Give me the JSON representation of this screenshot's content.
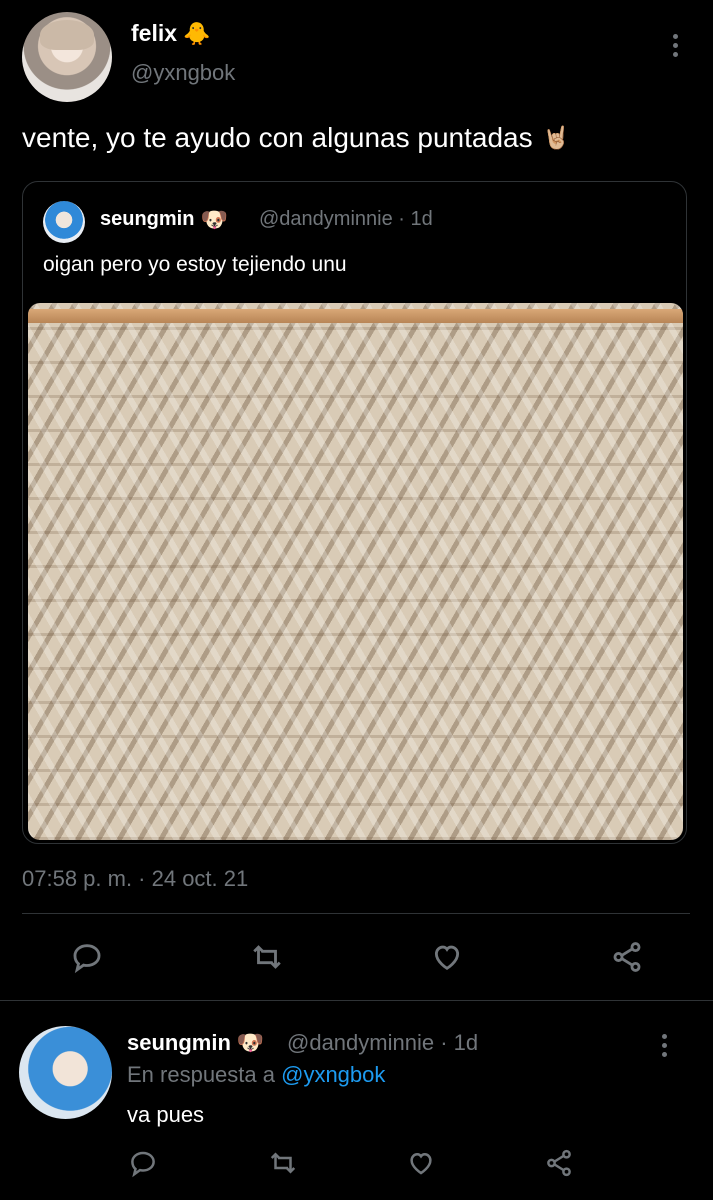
{
  "main_tweet": {
    "author_name": "felix",
    "author_emoji": "🐥",
    "handle": "@yxngbok",
    "text": "vente, yo te ayudo con algunas puntadas",
    "text_emoji": "🤘🏼",
    "timestamp": "07:58 p. m. · 24 oct. 21"
  },
  "quote": {
    "author_name": "seungmin",
    "author_emoji": "🐶",
    "handle_time": "@dandyminnie · 1d",
    "text": "oigan pero yo estoy tejiendo unu"
  },
  "reply": {
    "author_name": "seungmin",
    "author_emoji": "🐶",
    "handle_time": "@dandyminnie · 1d",
    "reply_prefix": "En respuesta a ",
    "reply_mention": "@yxngbok",
    "text": "va pues"
  },
  "icons": [
    "reply-icon",
    "retweet-icon",
    "like-icon",
    "share-icon",
    "more-icon"
  ],
  "colors": {
    "background": "#000000",
    "muted": "#71767b",
    "link": "#1d9bf0",
    "border": "#2f3336"
  }
}
